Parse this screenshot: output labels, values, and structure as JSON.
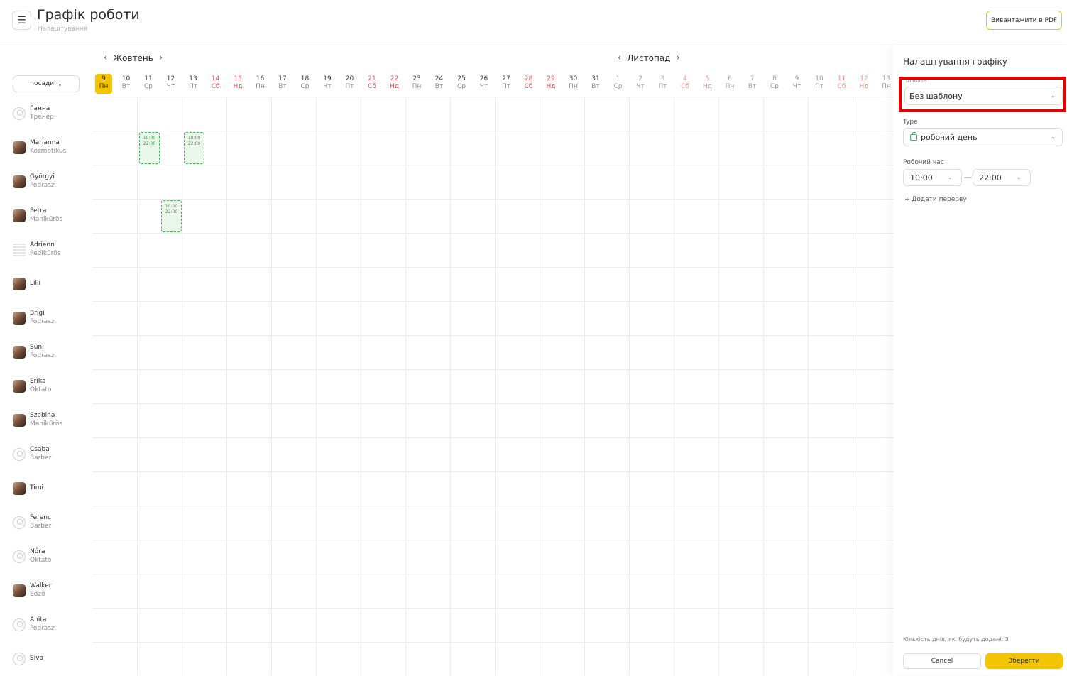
{
  "header": {
    "menu_icon": "☰",
    "title": "Графік роботи",
    "subtitle": "Налаштування",
    "pdf_button": "Вивантажити в PDF"
  },
  "filter": {
    "position_button": "посади",
    "chevron": "⌄"
  },
  "months": [
    {
      "name": "Жовтень",
      "prev": "‹",
      "next": "›"
    },
    {
      "name": "Листопад",
      "prev": "‹",
      "next": "›"
    }
  ],
  "days": [
    {
      "n": "9",
      "w": "Пн",
      "weekend": false,
      "today": true,
      "next": false
    },
    {
      "n": "10",
      "w": "Вт",
      "weekend": false,
      "today": false,
      "next": false
    },
    {
      "n": "11",
      "w": "Ср",
      "weekend": false,
      "today": false,
      "next": false
    },
    {
      "n": "12",
      "w": "Чт",
      "weekend": false,
      "today": false,
      "next": false
    },
    {
      "n": "13",
      "w": "Пт",
      "weekend": false,
      "today": false,
      "next": false
    },
    {
      "n": "14",
      "w": "Сб",
      "weekend": true,
      "today": false,
      "next": false
    },
    {
      "n": "15",
      "w": "Нд",
      "weekend": true,
      "today": false,
      "next": false
    },
    {
      "n": "16",
      "w": "Пн",
      "weekend": false,
      "today": false,
      "next": false
    },
    {
      "n": "17",
      "w": "Вт",
      "weekend": false,
      "today": false,
      "next": false
    },
    {
      "n": "18",
      "w": "Ср",
      "weekend": false,
      "today": false,
      "next": false
    },
    {
      "n": "19",
      "w": "Чт",
      "weekend": false,
      "today": false,
      "next": false
    },
    {
      "n": "20",
      "w": "Пт",
      "weekend": false,
      "today": false,
      "next": false
    },
    {
      "n": "21",
      "w": "Сб",
      "weekend": true,
      "today": false,
      "next": false
    },
    {
      "n": "22",
      "w": "Нд",
      "weekend": true,
      "today": false,
      "next": false
    },
    {
      "n": "23",
      "w": "Пн",
      "weekend": false,
      "today": false,
      "next": false
    },
    {
      "n": "24",
      "w": "Вт",
      "weekend": false,
      "today": false,
      "next": false
    },
    {
      "n": "25",
      "w": "Ср",
      "weekend": false,
      "today": false,
      "next": false
    },
    {
      "n": "26",
      "w": "Чт",
      "weekend": false,
      "today": false,
      "next": false
    },
    {
      "n": "27",
      "w": "Пт",
      "weekend": false,
      "today": false,
      "next": false
    },
    {
      "n": "28",
      "w": "Сб",
      "weekend": true,
      "today": false,
      "next": false
    },
    {
      "n": "29",
      "w": "Нд",
      "weekend": true,
      "today": false,
      "next": false
    },
    {
      "n": "30",
      "w": "Пн",
      "weekend": false,
      "today": false,
      "next": false
    },
    {
      "n": "31",
      "w": "Вт",
      "weekend": false,
      "today": false,
      "next": false
    },
    {
      "n": "1",
      "w": "Ср",
      "weekend": false,
      "today": false,
      "next": true
    },
    {
      "n": "2",
      "w": "Чт",
      "weekend": false,
      "today": false,
      "next": true
    },
    {
      "n": "3",
      "w": "Пт",
      "weekend": false,
      "today": false,
      "next": true
    },
    {
      "n": "4",
      "w": "Сб",
      "weekend": true,
      "today": false,
      "next": true
    },
    {
      "n": "5",
      "w": "Нд",
      "weekend": true,
      "today": false,
      "next": true
    },
    {
      "n": "6",
      "w": "Пн",
      "weekend": false,
      "today": false,
      "next": true
    },
    {
      "n": "7",
      "w": "Вт",
      "weekend": false,
      "today": false,
      "next": true
    },
    {
      "n": "8",
      "w": "Ср",
      "weekend": false,
      "today": false,
      "next": true
    },
    {
      "n": "9",
      "w": "Чт",
      "weekend": false,
      "today": false,
      "next": true
    },
    {
      "n": "10",
      "w": "Пт",
      "weekend": false,
      "today": false,
      "next": true
    },
    {
      "n": "11",
      "w": "Сб",
      "weekend": true,
      "today": false,
      "next": true
    },
    {
      "n": "12",
      "w": "Нд",
      "weekend": true,
      "today": false,
      "next": true
    },
    {
      "n": "13",
      "w": "Пн",
      "weekend": false,
      "today": false,
      "next": true
    }
  ],
  "employees": [
    {
      "name": "Ганна",
      "role": "Тренер",
      "avatar": "placeholder"
    },
    {
      "name": "Marianna",
      "role": "Kozmetikus",
      "avatar": "photo"
    },
    {
      "name": "Györgyi",
      "role": "Fodrasz",
      "avatar": "photo"
    },
    {
      "name": "Petra",
      "role": "Manikűrös",
      "avatar": "photo"
    },
    {
      "name": "Adrienn",
      "role": "Pedikűrös",
      "avatar": "doc"
    },
    {
      "name": "Lilli",
      "role": "",
      "avatar": "photo"
    },
    {
      "name": "Brigi",
      "role": "Fodrasz",
      "avatar": "photo"
    },
    {
      "name": "Süni",
      "role": "Fodrasz",
      "avatar": "photo"
    },
    {
      "name": "Erika",
      "role": "Oktato",
      "avatar": "photo"
    },
    {
      "name": "Szabina",
      "role": "Manikűrös",
      "avatar": "photo"
    },
    {
      "name": "Csaba",
      "role": "Barber",
      "avatar": "placeholder"
    },
    {
      "name": "Timi",
      "role": "",
      "avatar": "photo"
    },
    {
      "name": "Ferenc",
      "role": "Barber",
      "avatar": "placeholder"
    },
    {
      "name": "Nóra",
      "role": "Oktato",
      "avatar": "placeholder"
    },
    {
      "name": "Walker",
      "role": "Edző",
      "avatar": "photo"
    },
    {
      "name": "Anita",
      "role": "Fodrasz",
      "avatar": "placeholder"
    },
    {
      "name": "Siva",
      "role": "",
      "avatar": "placeholder"
    }
  ],
  "shifts": [
    {
      "employee": 1,
      "day": 1,
      "start": "10:00",
      "end": "22:00"
    },
    {
      "employee": 1,
      "day": 3,
      "start": "10:00",
      "end": "22:00"
    },
    {
      "employee": 3,
      "day": 2,
      "start": "10:00",
      "end": "22:00"
    }
  ],
  "panel": {
    "title": "Налаштування графіку",
    "template_label": "Шаблон",
    "template_value": "Без шаблону",
    "type_label": "Type",
    "type_value": "робочий день",
    "work_time_label": "Робочий час",
    "time_from": "10:00",
    "time_to": "22:00",
    "time_dash": "—",
    "add_break": "+  Додати перерву",
    "count_text": "Кількість днів, які будуть додані: 3",
    "cancel": "Cancel",
    "save": "Зберегти",
    "chevron": "⌄"
  },
  "colors": {
    "accent": "#f5c400",
    "weekend": "#e05050",
    "shift_border": "#3db35a",
    "highlight": "#e60000"
  }
}
